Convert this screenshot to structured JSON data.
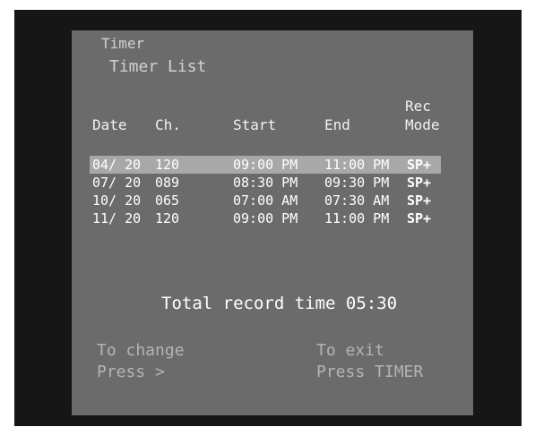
{
  "menu": {
    "title": "Timer",
    "subtitle": "Timer List"
  },
  "columns": {
    "date": "Date",
    "ch": "Ch.",
    "start": "Start",
    "end": "End",
    "rec": "Rec",
    "mode": "Mode"
  },
  "rows": [
    {
      "date": "04/ 20",
      "ch": "120",
      "start": "09:00 PM",
      "end": "11:00 PM",
      "mode": "SP+"
    },
    {
      "date": "07/ 20",
      "ch": "089",
      "start": "08:30 PM",
      "end": "09:30 PM",
      "mode": "SP+"
    },
    {
      "date": "10/ 20",
      "ch": "065",
      "start": "07:00 AM",
      "end": "07:30 AM",
      "mode": "SP+"
    },
    {
      "date": "11/ 20",
      "ch": "120",
      "start": "09:00 PM",
      "end": "11:00 PM",
      "mode": "SP+"
    }
  ],
  "selected_row": 0,
  "total": {
    "label": "Total record time",
    "value": "05:30"
  },
  "help": {
    "change_line1": "To change",
    "change_line2": "Press >",
    "exit_line1": "To exit",
    "exit_line2": "Press TIMER"
  },
  "colors": {
    "panel": "#6b6b6b",
    "highlight": "#a8a8a8",
    "frame": "#161616"
  }
}
